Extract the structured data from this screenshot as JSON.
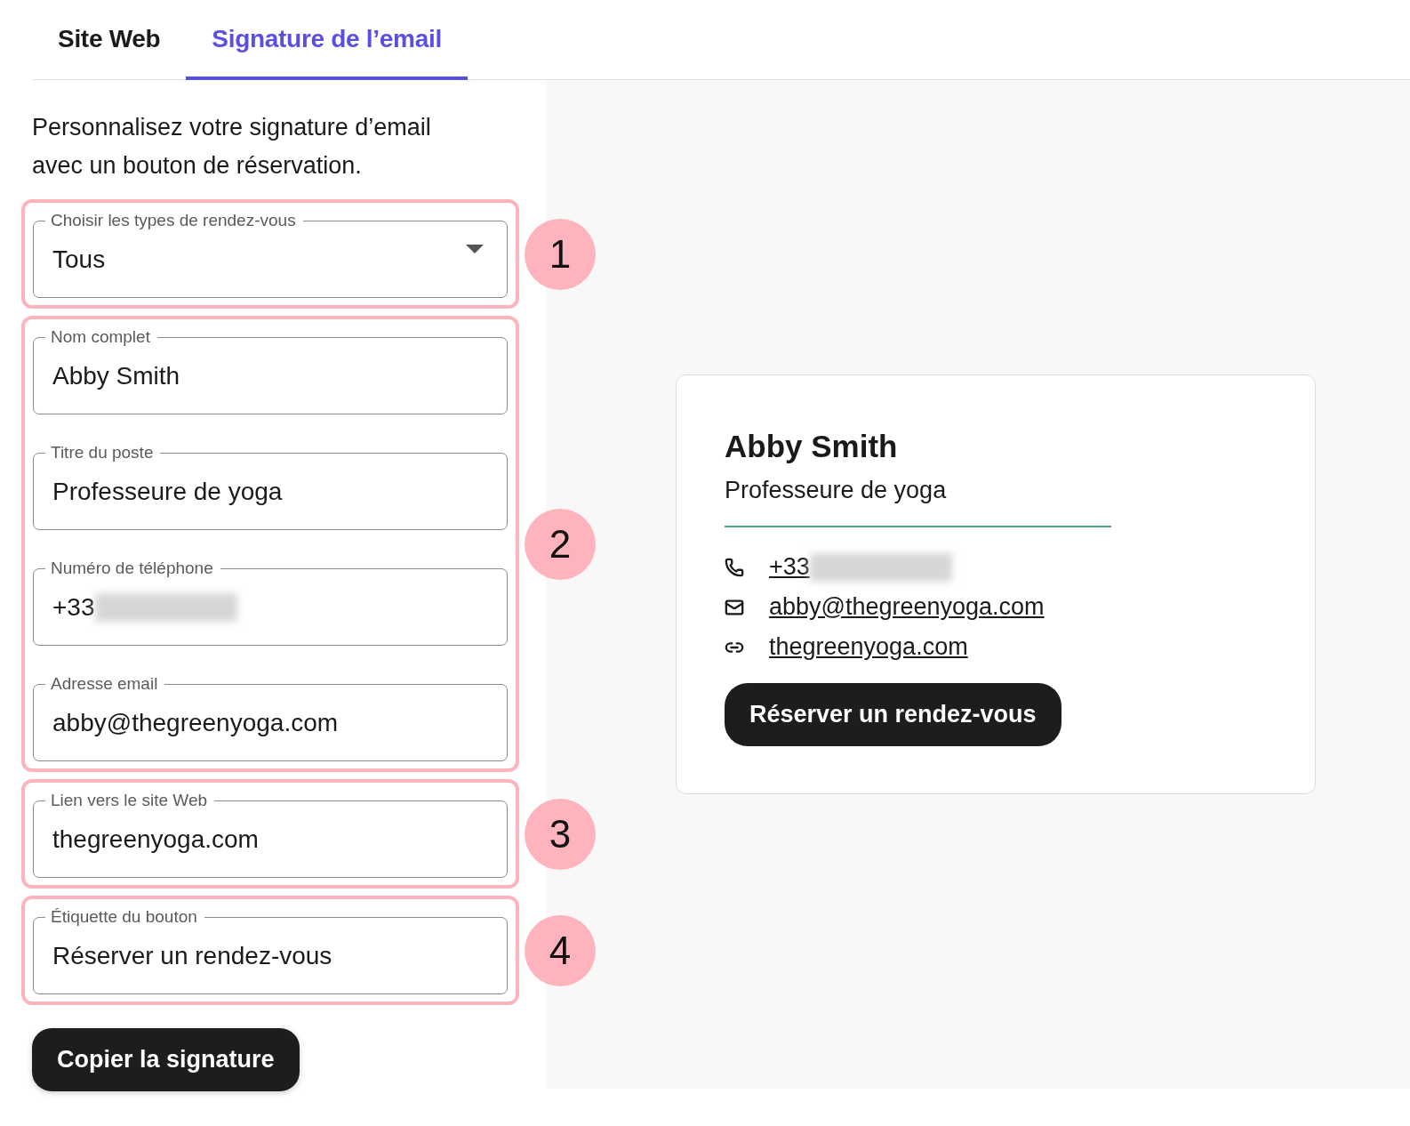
{
  "tabs": [
    {
      "label": "Site Web",
      "selected": false
    },
    {
      "label": "Signature de l’email",
      "selected": true
    }
  ],
  "intro": "Personnalisez votre signature d’email avec un bouton de réservation.",
  "groups": [
    {
      "callout": "1",
      "fields": [
        {
          "kind": "select",
          "label": "Choisir les types de rendez-vous",
          "value": "Tous",
          "redacted": false
        }
      ]
    },
    {
      "callout": "2",
      "fields": [
        {
          "kind": "text",
          "label": "Nom complet",
          "value": "Abby Smith",
          "redacted": false
        },
        {
          "kind": "text",
          "label": "Titre du poste",
          "value": "Professeure de yoga",
          "redacted": false
        },
        {
          "kind": "text",
          "label": "Numéro de téléphone",
          "value": "+33",
          "redacted": true
        },
        {
          "kind": "text",
          "label": "Adresse email",
          "value": "abby@thegreenyoga.com",
          "redacted": false
        }
      ]
    },
    {
      "callout": "3",
      "fields": [
        {
          "kind": "text",
          "label": "Lien vers le site Web",
          "value": "thegreenyoga.com",
          "redacted": false
        }
      ]
    },
    {
      "callout": "4",
      "fields": [
        {
          "kind": "text",
          "label": "Étiquette du bouton",
          "value": "Réserver un rendez-vous",
          "redacted": false
        }
      ]
    }
  ],
  "copy_button": "Copier la signature",
  "preview": {
    "name": "Abby Smith",
    "title": "Professeure de yoga",
    "contacts": [
      {
        "kind": "phone",
        "text": "+33",
        "redacted": true
      },
      {
        "kind": "email",
        "text": "abby@thegreenyoga.com",
        "redacted": false
      },
      {
        "kind": "web",
        "text": "thegreenyoga.com",
        "redacted": false
      }
    ],
    "button": "Réserver un rendez-vous"
  }
}
